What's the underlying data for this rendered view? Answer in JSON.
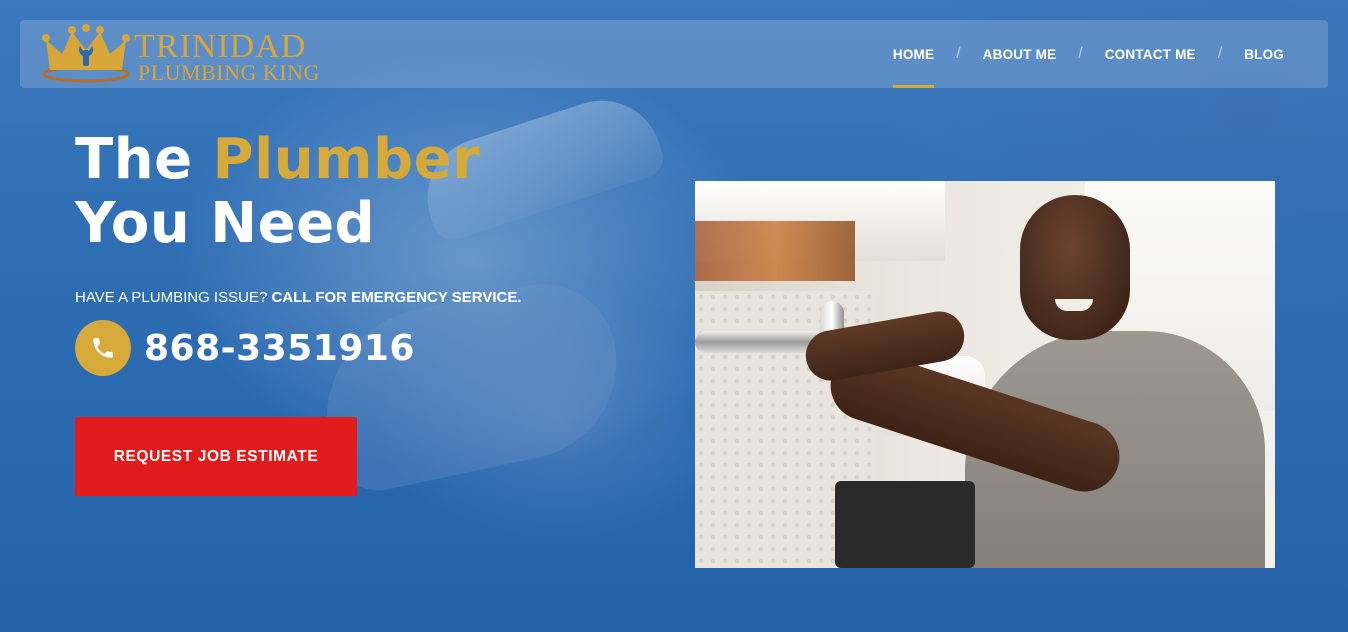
{
  "brand": {
    "line1": "TRINIDAD",
    "line2": "PLUMBING KING",
    "logo_icon": "crown-wrench-icon",
    "color": "#d9a63a"
  },
  "nav": {
    "items": [
      {
        "label": "HOME",
        "active": true
      },
      {
        "label": "ABOUT ME",
        "active": false
      },
      {
        "label": "CONTACT ME",
        "active": false
      },
      {
        "label": "BLOG",
        "active": false
      }
    ],
    "separator": "/",
    "active_underline_color": "#d5a93a"
  },
  "hero": {
    "headline_part1": "The ",
    "headline_accent": "Plumber",
    "headline_part2": "You Need",
    "tagline_normal": "HAVE A PLUMBING ISSUE? ",
    "tagline_bold": "CALL FOR EMERGENCY SERVICE.",
    "phone_icon": "phone-icon",
    "phone": "868-3351916",
    "cta_label": "REQUEST JOB ESTIMATE",
    "photo_subject": "plumber-photo"
  },
  "colors": {
    "accent": "#d5a93a",
    "cta": "#e11b1b",
    "background": "#2a6cb0"
  }
}
